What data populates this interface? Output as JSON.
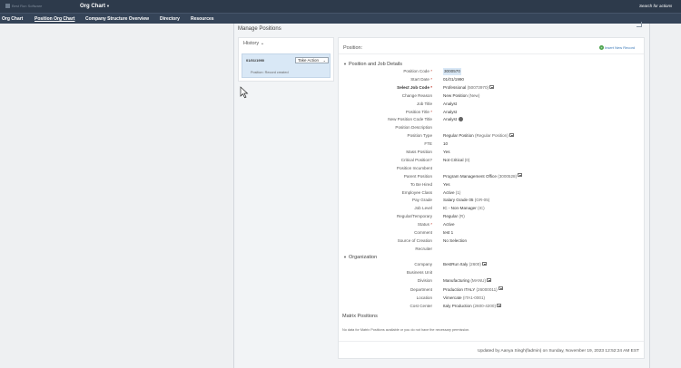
{
  "header": {
    "logo_text": "Best Run Software",
    "app_title": "Org Chart",
    "search_placeholder": "Search for actions"
  },
  "nav": {
    "items": [
      {
        "label": "Org Chart",
        "active": false
      },
      {
        "label": "Position Org Chart",
        "active": true
      },
      {
        "label": "Company Structure Overview",
        "active": false
      },
      {
        "label": "Directory",
        "active": false
      },
      {
        "label": "Resources",
        "active": false
      }
    ]
  },
  "page": {
    "title": "Manage Positions"
  },
  "history": {
    "label": "History",
    "entry": {
      "date": "01/01/1990",
      "action_label": "Take Action",
      "status": "Position: Record created"
    }
  },
  "position": {
    "header": "Position:",
    "insert_label": "Insert New Record",
    "section_job": "Position and Job Details",
    "fields": [
      {
        "label": "Position Code",
        "required": true,
        "value": "3000570",
        "selected": true
      },
      {
        "label": "Start Date",
        "required": true,
        "value": "01/01/1990"
      },
      {
        "label": "Select Job Code",
        "required": true,
        "bold": true,
        "value": "Professional",
        "code": "(50073970)",
        "more": true
      },
      {
        "label": "Change Reason",
        "value": "New Position",
        "code": "(New)"
      },
      {
        "label": "Job Title",
        "value": "Analyst"
      },
      {
        "label": "Position Title",
        "required": true,
        "value": "Analyst"
      },
      {
        "label": "New Position Code Title",
        "value": "Analyst",
        "info": true
      },
      {
        "label": "Position Description",
        "value": ""
      },
      {
        "label": "Position Type",
        "value": "Regular Position",
        "code": "(Regular Position)",
        "more": true
      },
      {
        "label": "FTE",
        "value": "10"
      },
      {
        "label": "Mass Position",
        "value": "Yes"
      },
      {
        "label": "Critical Position?",
        "value": "Not Critical",
        "code": "(0)"
      },
      {
        "label": "Position Incumbent",
        "value": ""
      },
      {
        "label": "Parent Position",
        "value": "Program Management Office",
        "code": "(3000528)",
        "more": true
      },
      {
        "label": "To Be Hired",
        "value": "Yes"
      },
      {
        "label": "Employee Class",
        "value": "Active",
        "code": "(1)"
      },
      {
        "label": "Pay Grade",
        "value": "Salary Grade 05",
        "code": "(GR-05)"
      },
      {
        "label": "Job Level",
        "value": "IC - Non-Manager",
        "code": "(IC)"
      },
      {
        "label": "Regular/Temporary",
        "value": "Regular",
        "code": "(R)"
      },
      {
        "label": "Status",
        "required": true,
        "value": "Active"
      },
      {
        "label": "Comment",
        "value": "test 1"
      },
      {
        "label": "Source of Creation",
        "value": "No Selection"
      },
      {
        "label": "Recruiter",
        "value": ""
      }
    ],
    "section_org": "Organization",
    "org_fields": [
      {
        "label": "Company",
        "value": "BestRun Italy",
        "code": "(2600)",
        "more": true
      },
      {
        "label": "Business Unit",
        "value": ""
      },
      {
        "label": "Division",
        "value": "Manufacturing",
        "code": "(MANU)",
        "more": true
      },
      {
        "label": "Department",
        "value": "Production ITALY",
        "code": "(26000011)",
        "more": true
      },
      {
        "label": "Location",
        "value": "Vimercate",
        "code": "(ITA1-0001)"
      },
      {
        "label": "Cost Center",
        "value": "Italy Production",
        "code": "(2600-4200)",
        "more": true
      }
    ],
    "matrix_title": "Matrix Positions",
    "matrix_note": "No data for Matrix Positions available or you do not have the necessary permission.",
    "updated_text": "Updated by Aanya Singh(fadmin) on Sunday, November 19, 2023 12:52:24 AM EST"
  }
}
